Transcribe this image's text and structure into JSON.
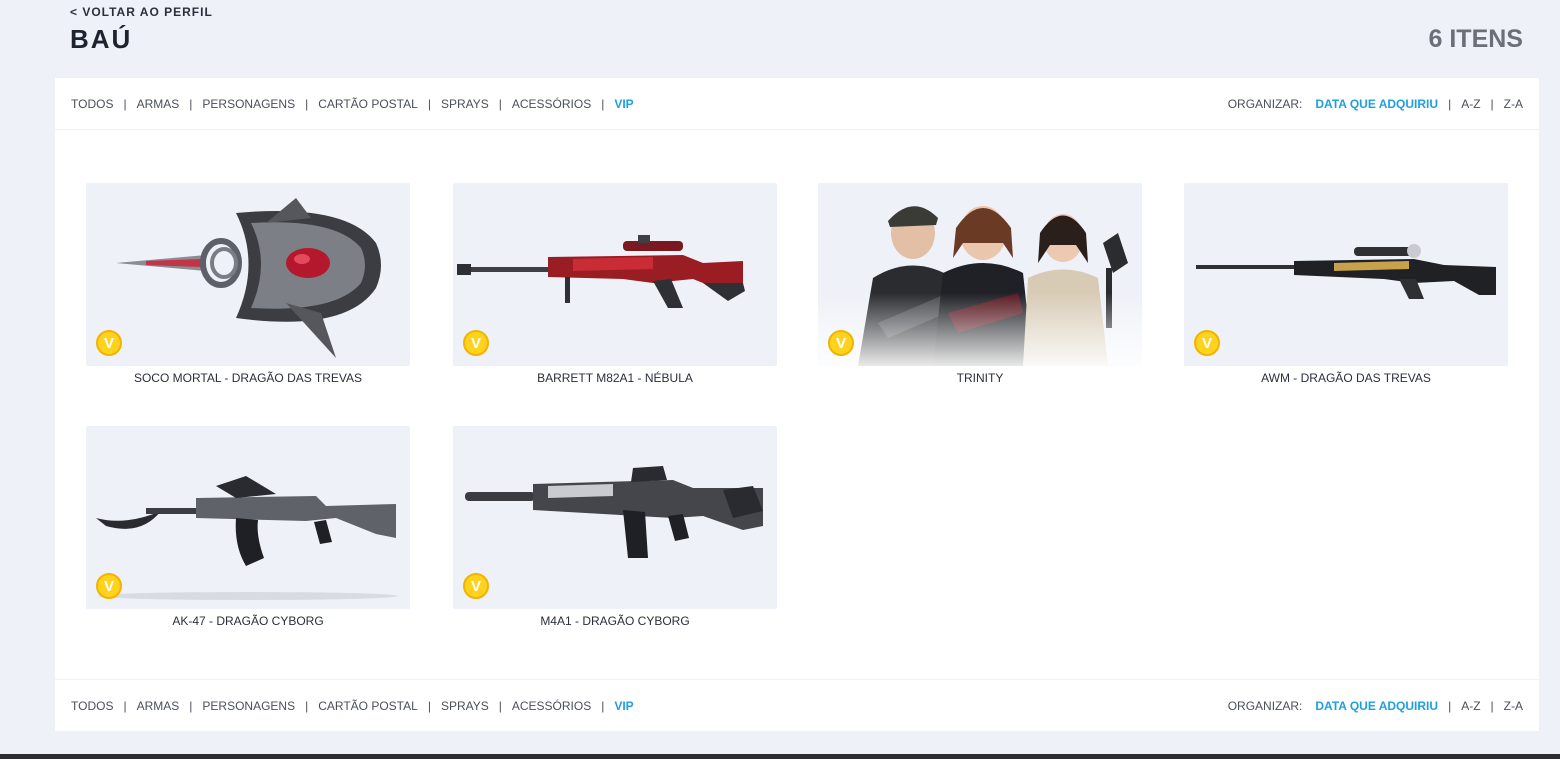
{
  "header": {
    "back_label": "< VOLTAR AO PERFIL",
    "title": "BAÚ",
    "count": "6 ITENS"
  },
  "filters": [
    {
      "label": "TODOS",
      "active": false
    },
    {
      "label": "ARMAS",
      "active": false
    },
    {
      "label": "PERSONAGENS",
      "active": false
    },
    {
      "label": "CARTÃO POSTAL",
      "active": false
    },
    {
      "label": "SPRAYS",
      "active": false
    },
    {
      "label": "ACESSÓRIOS",
      "active": false
    },
    {
      "label": "VIP",
      "active": true
    }
  ],
  "sort": {
    "label": "ORGANIZAR:",
    "options": [
      {
        "label": "DATA QUE ADQUIRIU",
        "active": true
      },
      {
        "label": "A-Z",
        "active": false
      },
      {
        "label": "Z-A",
        "active": false
      }
    ]
  },
  "items": [
    {
      "name": "SOCO MORTAL - DRAGÃO DAS TREVAS",
      "icon": "knuckle-blade-icon",
      "badge": "V"
    },
    {
      "name": "BARRETT M82A1 - NÉBULA",
      "icon": "sniper-rifle-icon",
      "badge": "V"
    },
    {
      "name": "TRINITY",
      "icon": "characters-icon",
      "badge": "V"
    },
    {
      "name": "AWM - DRAGÃO DAS TREVAS",
      "icon": "sniper-rifle-icon",
      "badge": "V"
    },
    {
      "name": "AK-47 - DRAGÃO CYBORG",
      "icon": "assault-rifle-icon",
      "badge": "V"
    },
    {
      "name": "M4A1 - DRAGÃO CYBORG",
      "icon": "assault-rifle-icon",
      "badge": "V"
    }
  ],
  "colors": {
    "accent": "#1f9fe0",
    "background": "#eef1f7",
    "vip_badge": "#ffd21e"
  }
}
